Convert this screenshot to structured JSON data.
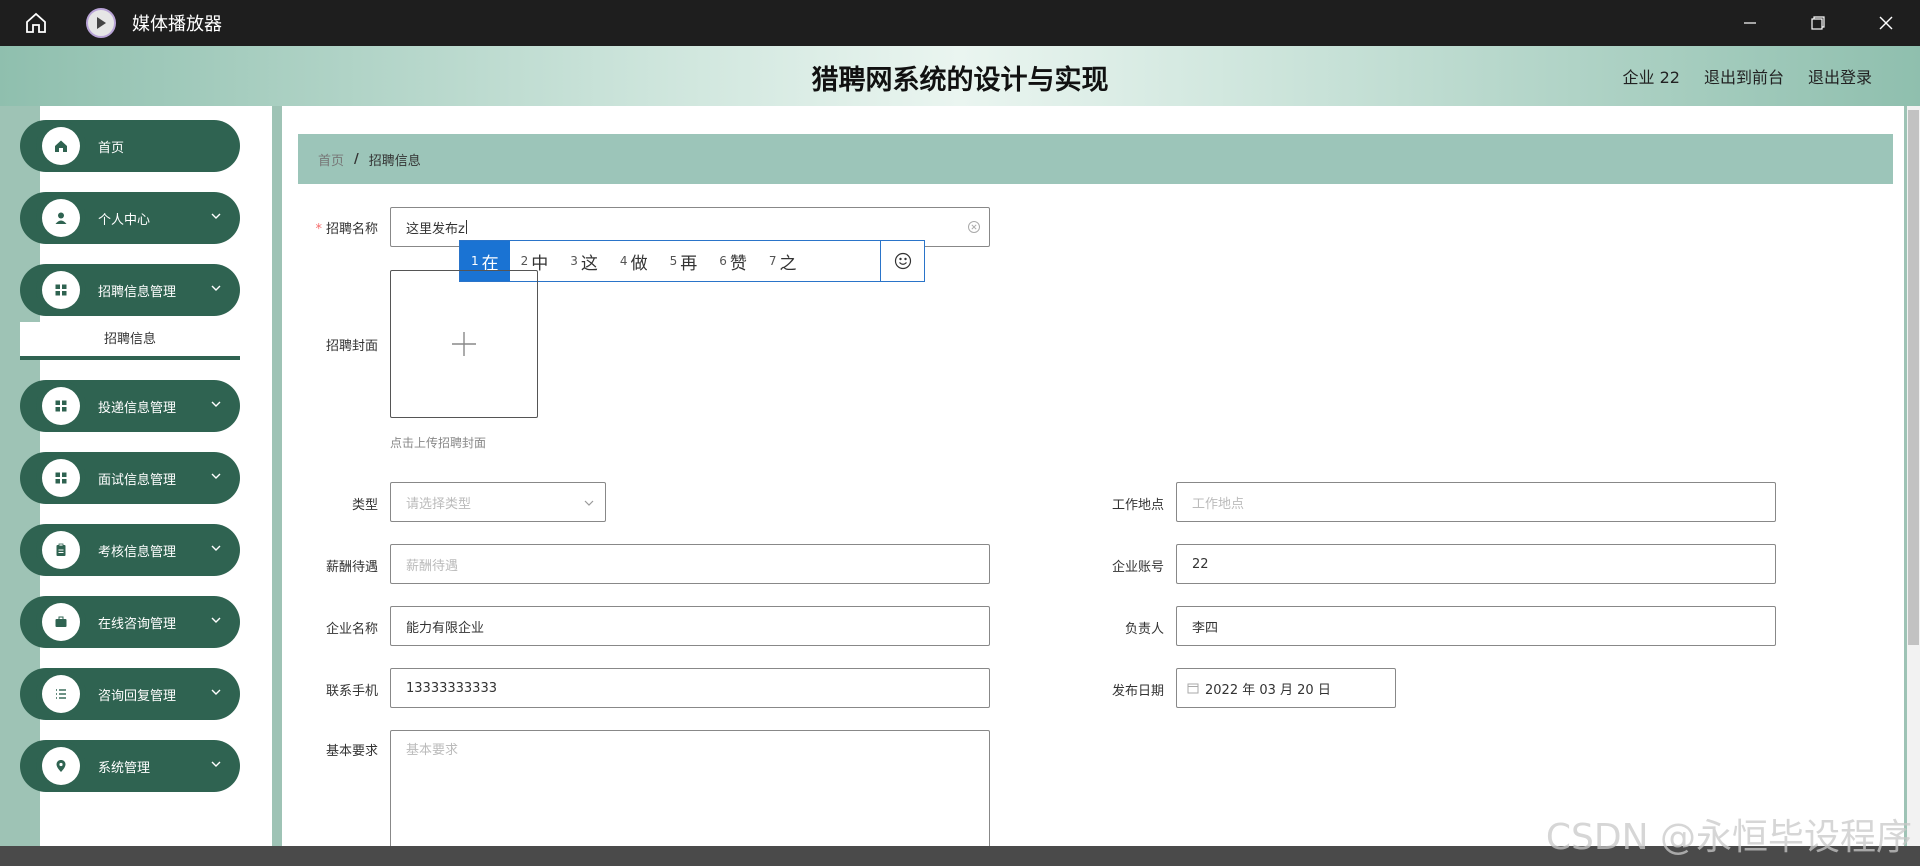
{
  "window": {
    "title": "媒体播放器",
    "home_icon": "home-icon",
    "app_icon": "play-icon",
    "controls": [
      "minimize-icon",
      "restore-icon",
      "close-icon"
    ]
  },
  "header": {
    "title": "猎聘网系统的设计与实现",
    "links": {
      "user": "企业 22",
      "frontend": "退出到前台",
      "logout": "退出登录"
    }
  },
  "sidebar": {
    "accent": "#2f6351",
    "items": [
      {
        "label": "首页",
        "icon": "home-icon"
      },
      {
        "label": "个人中心",
        "icon": "user-icon"
      },
      {
        "label": "招聘信息管理",
        "icon": "grid-icon"
      },
      {
        "label": "投递信息管理",
        "icon": "grid-icon"
      },
      {
        "label": "面试信息管理",
        "icon": "grid-icon"
      },
      {
        "label": "考核信息管理",
        "icon": "clipboard-icon"
      },
      {
        "label": "在线咨询管理",
        "icon": "briefcase-icon"
      },
      {
        "label": "咨询回复管理",
        "icon": "list-icon"
      },
      {
        "label": "系统管理",
        "icon": "location-icon"
      }
    ],
    "submenu": "招聘信息"
  },
  "breadcrumb": {
    "home": "首页",
    "separator": "/",
    "current": "招聘信息"
  },
  "form": {
    "name": {
      "label": "招聘名称",
      "value": "这里发布z"
    },
    "cover": {
      "label": "招聘封面",
      "tip": "点击上传招聘封面"
    },
    "type": {
      "label": "类型",
      "placeholder": "请选择类型"
    },
    "location": {
      "label": "工作地点",
      "placeholder": "工作地点"
    },
    "salary": {
      "label": "薪酬待遇",
      "placeholder": "薪酬待遇"
    },
    "account": {
      "label": "企业账号",
      "value": "22"
    },
    "company": {
      "label": "企业名称",
      "value": "能力有限企业"
    },
    "manager": {
      "label": "负责人",
      "value": "李四"
    },
    "phone": {
      "label": "联系手机",
      "value": "13333333333"
    },
    "date": {
      "label": "发布日期",
      "value": "2022 年 03 月 20 日"
    },
    "requirements": {
      "label": "基本要求",
      "placeholder": "基本要求"
    }
  },
  "ime": {
    "candidates": [
      {
        "num": "1",
        "char": "在"
      },
      {
        "num": "2",
        "char": "中"
      },
      {
        "num": "3",
        "char": "这"
      },
      {
        "num": "4",
        "char": "做"
      },
      {
        "num": "5",
        "char": "再"
      },
      {
        "num": "6",
        "char": "赞"
      },
      {
        "num": "7",
        "char": "之"
      }
    ],
    "selected_color": "#1a73d3"
  },
  "footer": {
    "watermark": "CSDN @永恒毕设程序"
  }
}
